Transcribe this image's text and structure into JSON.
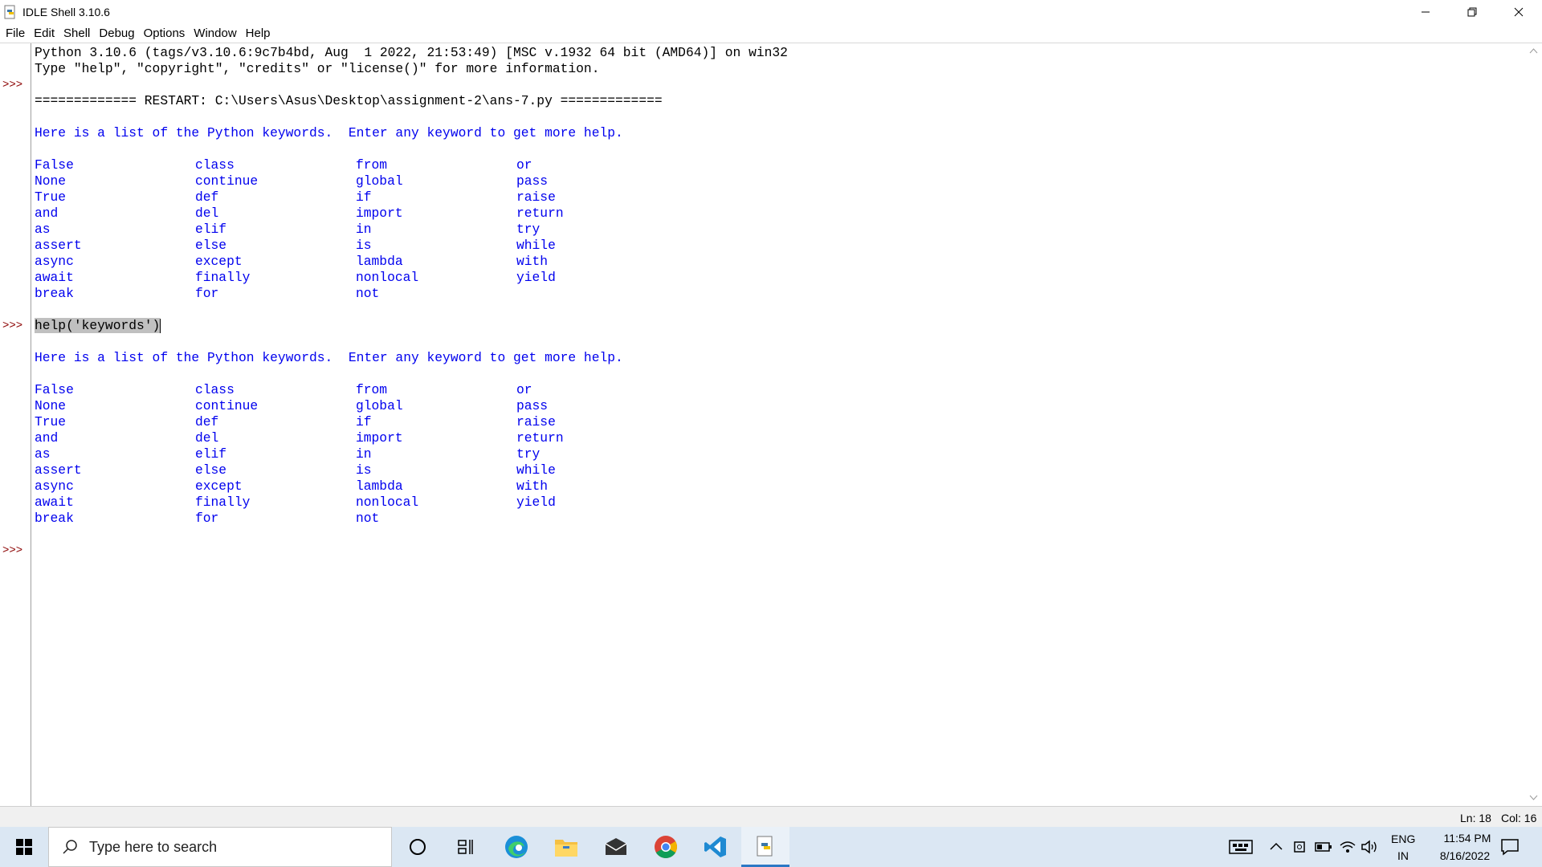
{
  "window": {
    "title": "IDLE Shell 3.10.6",
    "icon": "python-idle-icon"
  },
  "menu": [
    "File",
    "Edit",
    "Shell",
    "Debug",
    "Options",
    "Window",
    "Help"
  ],
  "shell": {
    "banner_line1": "Python 3.10.6 (tags/v3.10.6:9c7b4bd, Aug  1 2022, 21:53:49) [MSC v.1932 64 bit (AMD64)] on win32",
    "banner_line2": "Type \"help\", \"copyright\", \"credits\" or \"license()\" for more information.",
    "prompt": ">>>",
    "restart_line": "============= RESTART: C:\\Users\\Asus\\Desktop\\assignment-2\\ans-7.py =============",
    "help_intro": "Here is a list of the Python keywords.  Enter any keyword to get more help.",
    "command": "help('keywords')",
    "keyword_columns": [
      [
        "False",
        "None",
        "True",
        "and",
        "as",
        "assert",
        "async",
        "await",
        "break"
      ],
      [
        "class",
        "continue",
        "def",
        "del",
        "elif",
        "else",
        "except",
        "finally",
        "for"
      ],
      [
        "from",
        "global",
        "if",
        "import",
        "in",
        "is",
        "lambda",
        "nonlocal",
        "not"
      ],
      [
        "or",
        "pass",
        "raise",
        "return",
        "try",
        "while",
        "with",
        "yield"
      ]
    ],
    "colors": {
      "output": "#0000ee",
      "prompt": "#8b0000",
      "selection": "#c0c0c0"
    }
  },
  "status": {
    "line": "Ln: 18",
    "col": "Col: 16"
  },
  "taskbar": {
    "search_placeholder": "Type here to search",
    "apps": [
      "cortana-icon",
      "task-view-icon",
      "edge-icon",
      "file-explorer-icon",
      "mail-icon",
      "chrome-icon",
      "vscode-icon",
      "python-idle-icon"
    ],
    "lang_top": "ENG",
    "lang_bottom": "IN",
    "time": "11:54 PM",
    "date": "8/16/2022"
  }
}
